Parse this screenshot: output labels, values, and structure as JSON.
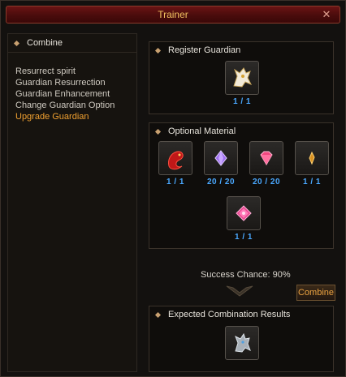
{
  "window": {
    "title": "Trainer"
  },
  "left": {
    "header": "Combine",
    "items": [
      {
        "label": "Resurrect spirit"
      },
      {
        "label": "Guardian Resurrection"
      },
      {
        "label": "Guardian Enhancement"
      },
      {
        "label": "Change Guardian Option"
      },
      {
        "label": "Upgrade Guardian"
      }
    ]
  },
  "register": {
    "header": "Register Guardian",
    "slot": {
      "icon": "guardian-horse-icon",
      "count": "1 / 1"
    }
  },
  "optional": {
    "header": "Optional Material",
    "slots": [
      {
        "icon": "red-dragon-icon",
        "count": "1 / 1"
      },
      {
        "icon": "purple-gem-icon",
        "count": "20 / 20"
      },
      {
        "icon": "pink-gem-icon",
        "count": "20 / 20"
      },
      {
        "icon": "gold-shard-icon",
        "count": "1 / 1"
      },
      {
        "icon": "pink-crystal-icon",
        "count": "1 / 1"
      }
    ]
  },
  "result": {
    "success_text": "Success Chance: 90%",
    "combine_label": "Combine",
    "header": "Expected Combination Results",
    "slot": {
      "icon": "silver-guardian-icon"
    }
  },
  "colors": {
    "accent": "#f0a030",
    "count": "#4aa8ff",
    "title": "#f0c060"
  }
}
